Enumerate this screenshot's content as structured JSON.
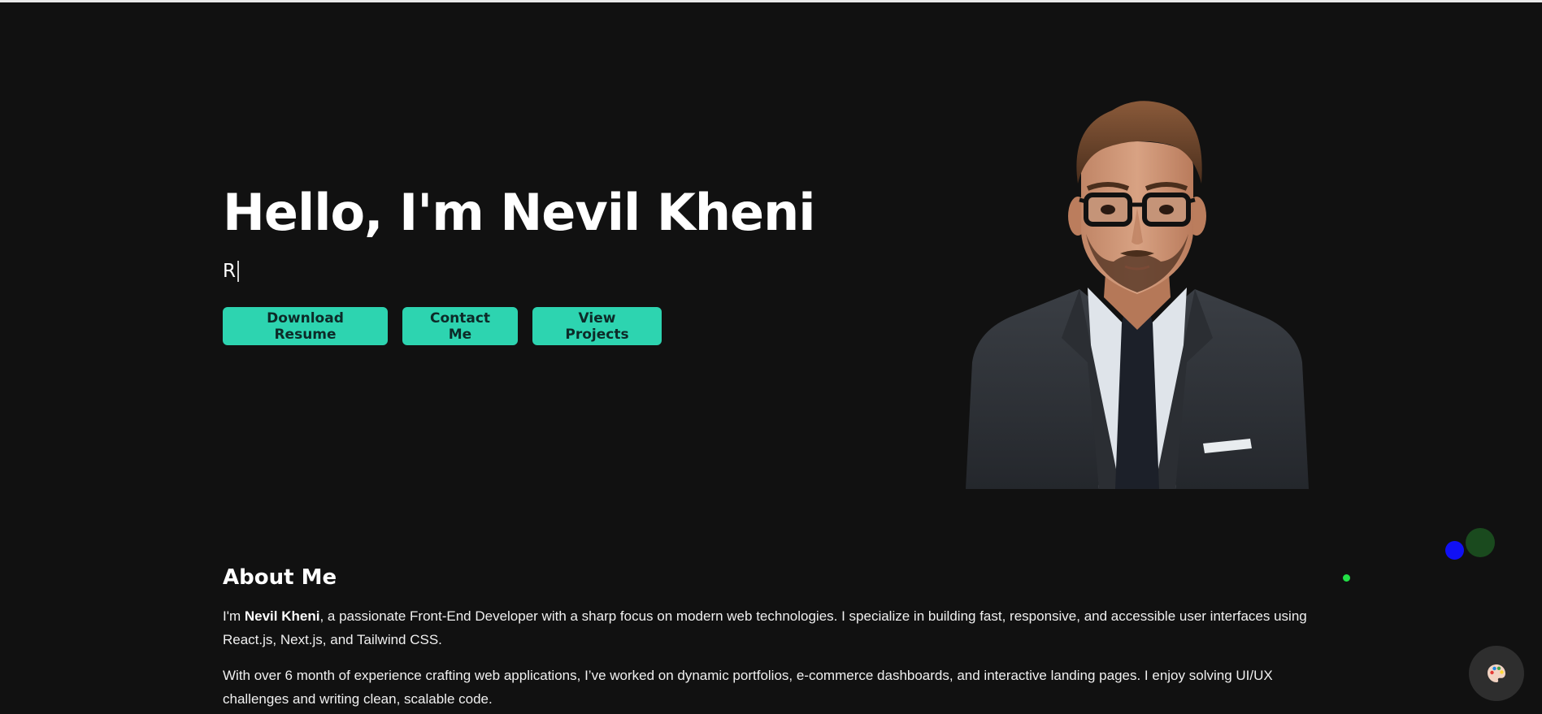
{
  "hero": {
    "title": "Hello, I'm Nevil Kheni",
    "typed_text": "R",
    "buttons": {
      "download_resume": "Download Resume",
      "contact_me": "Contact Me",
      "view_projects": "View Projects"
    }
  },
  "about": {
    "title": "About Me",
    "p1_prefix": "I'm ",
    "p1_name": "Nevil Kheni",
    "p1_rest": ", a passionate Front-End Developer with a sharp focus on modern web technologies. I specialize in building fast, responsive, and accessible user interfaces using React.js, Next.js, and Tailwind CSS.",
    "p2": "With over 6 month of experience crafting web applications, I’ve worked on dynamic portfolios, e-commerce dashboards, and interactive landing pages. I enjoy solving UI/UX challenges and writing clean, scalable code."
  },
  "icons": {
    "theme_toggle": "palette-icon"
  },
  "colors": {
    "background": "#111111",
    "accent": "#2dd4b0",
    "button_text": "#0d2a28"
  }
}
